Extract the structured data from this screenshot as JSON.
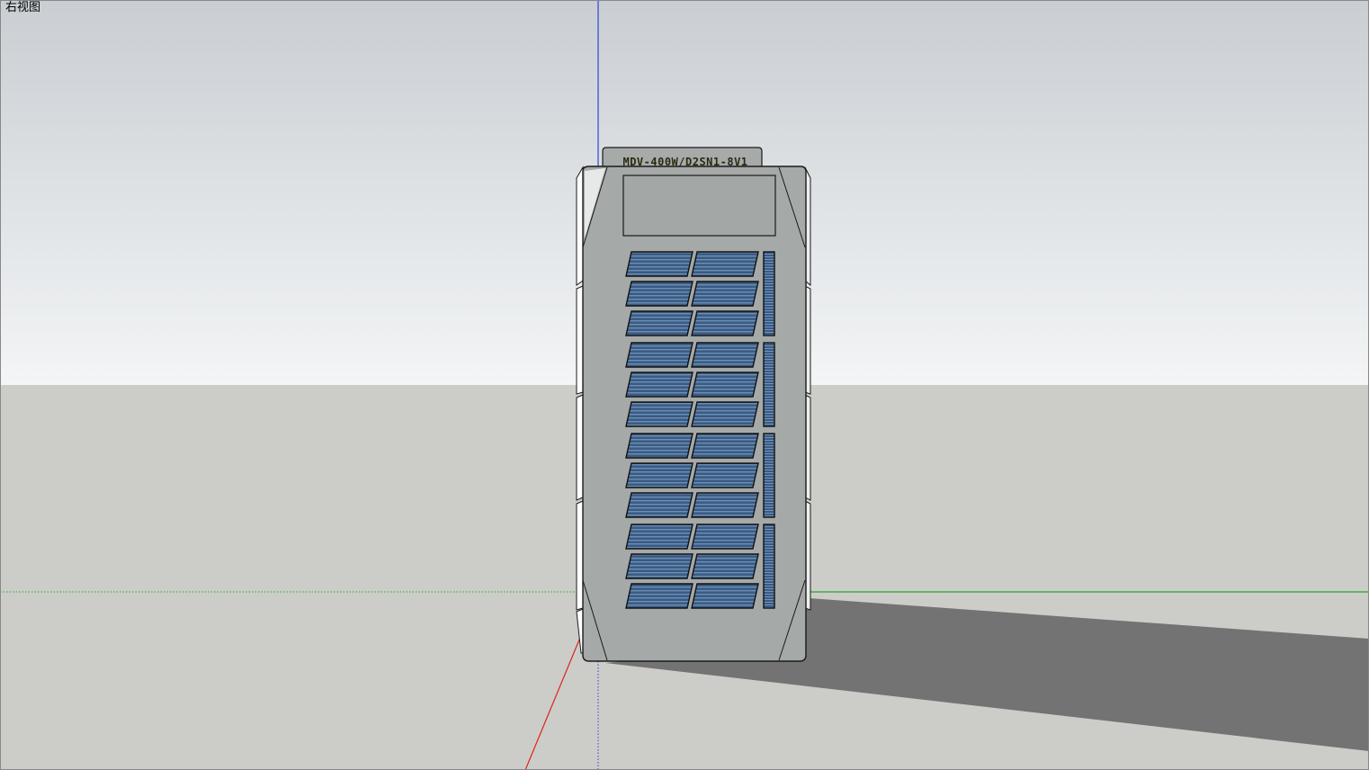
{
  "viewport": {
    "view_name": "右视图"
  },
  "model": {
    "label": "MDV-400W/D2SN1-8V1"
  },
  "colors": {
    "sky_top": "#c9ced3",
    "sky_bottom": "#f2f4f5",
    "ground": "#cccdc8",
    "shadow": "#737373",
    "body": "#a5a9a8",
    "body_edge": "#1a1a1a",
    "side_highlight": "#e9ebea",
    "vent_blue": "#3d5f86",
    "axis_blue": "#3344cc",
    "axis_green": "#2aa52a",
    "axis_red": "#dd2222"
  }
}
